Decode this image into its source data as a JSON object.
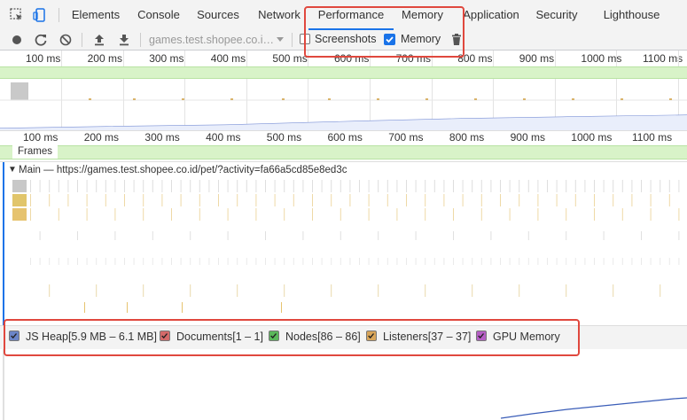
{
  "tabs": [
    "Elements",
    "Console",
    "Sources",
    "Network",
    "Performance",
    "Memory",
    "Application",
    "Security",
    "Lighthouse"
  ],
  "active_tab": "Performance",
  "toolbar": {
    "url_select": "games.test.shopee.co.i…",
    "screenshots_label": "Screenshots",
    "screenshots_checked": false,
    "memory_label": "Memory",
    "memory_checked": true
  },
  "timeline_ticks": [
    "100 ms",
    "200 ms",
    "300 ms",
    "400 ms",
    "500 ms",
    "600 ms",
    "700 ms",
    "800 ms",
    "900 ms",
    "1000 ms",
    "1100 ms"
  ],
  "frames_label": "Frames",
  "main_track": {
    "toggle": "▼",
    "label": "Main — https://games.test.shopee.co.id/pet/?activity=fa66a5cd85e8ed3c"
  },
  "legend": [
    {
      "label": "JS Heap[5.9 MB – 6.1 MB]",
      "color": "#6b85c8",
      "checked": true
    },
    {
      "label": "Documents[1 – 1]",
      "color": "#d46a6a",
      "checked": true
    },
    {
      "label": "Nodes[86 – 86]",
      "color": "#5ab85a",
      "checked": true
    },
    {
      "label": "Listeners[37 – 37]",
      "color": "#d8a55a",
      "checked": true
    },
    {
      "label": "GPU Memory",
      "color": "#b55ec4",
      "checked": true
    }
  ],
  "colors": {
    "accent": "#1a73e8",
    "highlight": "#e0483e",
    "frames_green": "#d8f3c8"
  }
}
